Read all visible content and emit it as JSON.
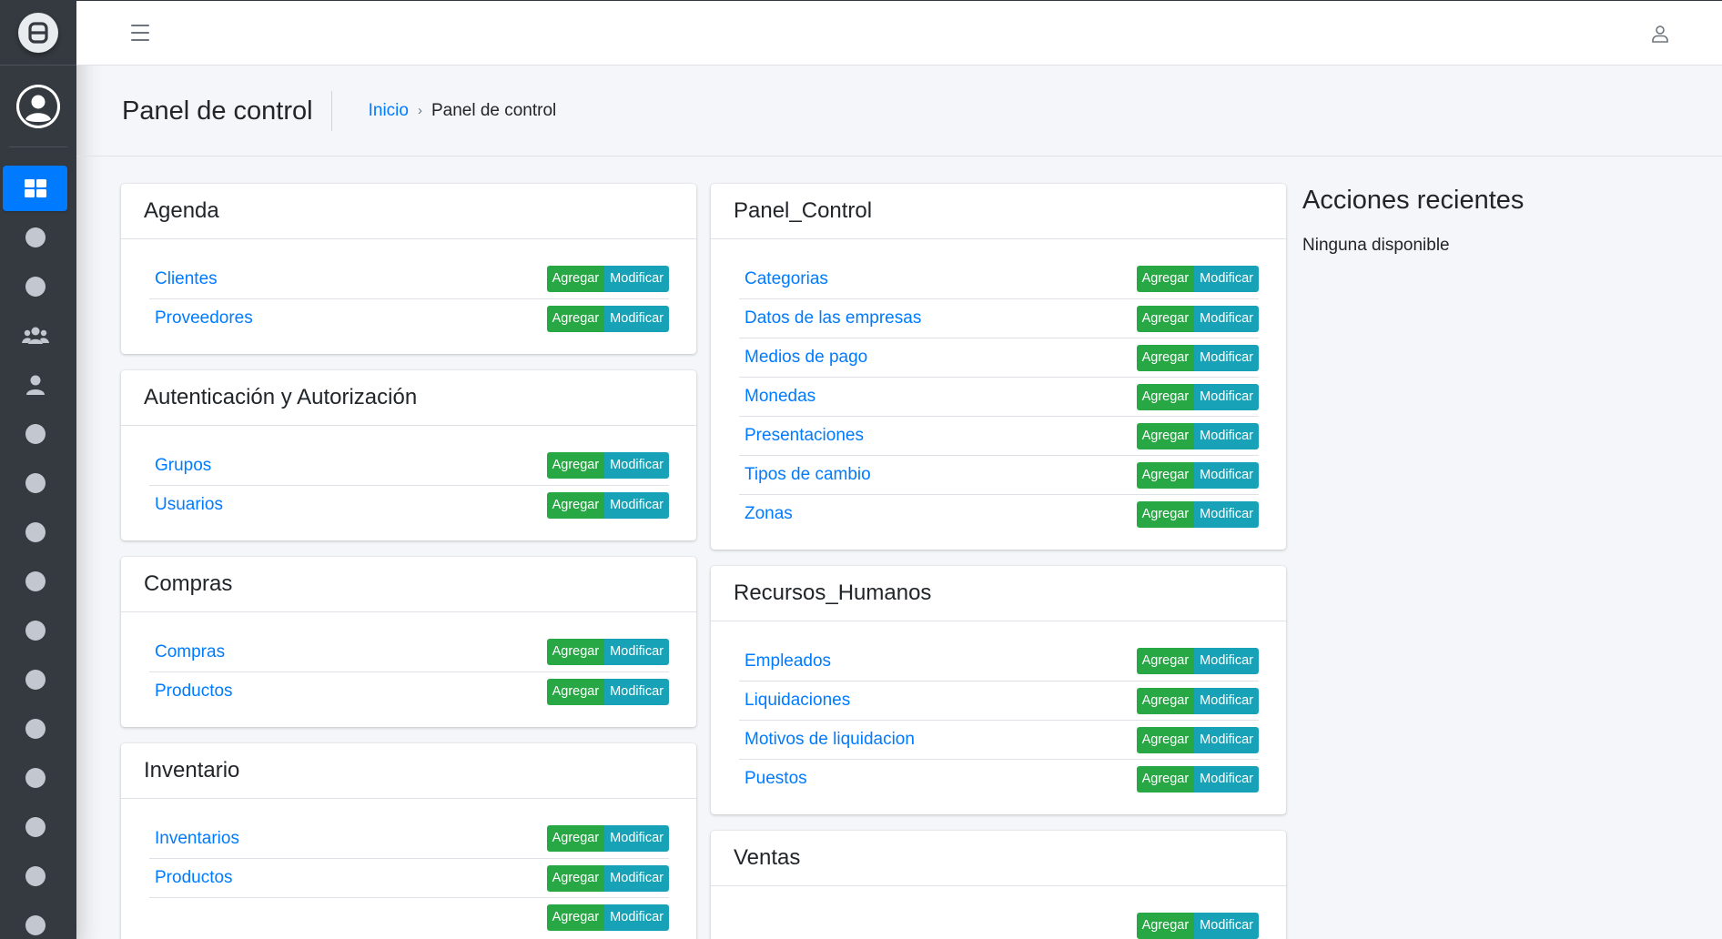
{
  "header": {
    "page_title": "Panel de control",
    "breadcrumb": {
      "home": "Inicio",
      "separator": "›",
      "current": "Panel de control"
    }
  },
  "sidebar": {
    "brand_icon": "brand-logo-icon",
    "avatar_icon": "user-avatar-icon",
    "items": [
      {
        "icon": "dashboard-icon",
        "active": true
      },
      {
        "icon": "circle-icon"
      },
      {
        "icon": "circle-icon"
      },
      {
        "icon": "users-icon"
      },
      {
        "icon": "user-icon"
      },
      {
        "icon": "circle-icon"
      },
      {
        "icon": "circle-icon"
      },
      {
        "icon": "circle-icon"
      },
      {
        "icon": "circle-icon"
      },
      {
        "icon": "circle-icon"
      },
      {
        "icon": "circle-icon"
      },
      {
        "icon": "circle-icon"
      },
      {
        "icon": "circle-icon"
      },
      {
        "icon": "circle-icon"
      },
      {
        "icon": "circle-icon"
      },
      {
        "icon": "circle-icon"
      }
    ]
  },
  "buttons": {
    "add_label": "Agregar",
    "edit_label": "Modificar"
  },
  "columns": [
    [
      {
        "title": "Agenda",
        "items": [
          "Clientes",
          "Proveedores"
        ]
      },
      {
        "title": "Autenticación y Autorización",
        "items": [
          "Grupos",
          "Usuarios"
        ]
      },
      {
        "title": "Compras",
        "items": [
          "Compras",
          "Productos"
        ]
      },
      {
        "title": "Inventario",
        "items": [
          "Inventarios",
          "Productos",
          ""
        ]
      }
    ],
    [
      {
        "title": "Panel_Control",
        "items": [
          "Categorias",
          "Datos de las empresas",
          "Medios de pago",
          "Monedas",
          "Presentaciones",
          "Tipos de cambio",
          "Zonas"
        ]
      },
      {
        "title": "Recursos_Humanos",
        "items": [
          "Empleados",
          "Liquidaciones",
          "Motivos de liquidacion",
          "Puestos"
        ]
      },
      {
        "title": "Ventas",
        "items": [
          ""
        ]
      }
    ]
  ],
  "recent_actions": {
    "title": "Acciones recientes",
    "empty_text": "Ninguna disponible"
  },
  "colors": {
    "sidebar": "#343a40",
    "primary": "#007bff",
    "success": "#28a745",
    "info": "#17a2b8"
  }
}
